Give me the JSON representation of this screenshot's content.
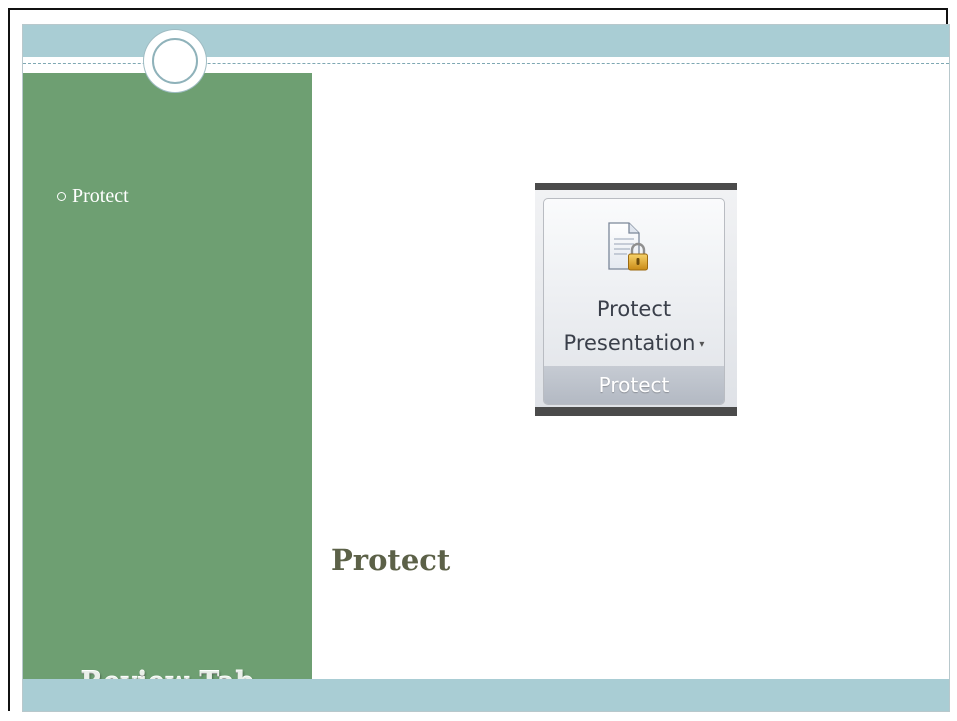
{
  "slide": {
    "bullets": [
      {
        "text": "Protect"
      }
    ],
    "panel_title": "Review Tab",
    "heading": "Protect"
  },
  "ribbon": {
    "button_line1": "Protect",
    "button_line2": "Presentation",
    "caret": "▾",
    "group_label": "Protect",
    "icon": "document-lock-icon"
  },
  "colors": {
    "band": "#a9cdd4",
    "side_panel": "#6e9f72",
    "heading": "#5c6148"
  }
}
